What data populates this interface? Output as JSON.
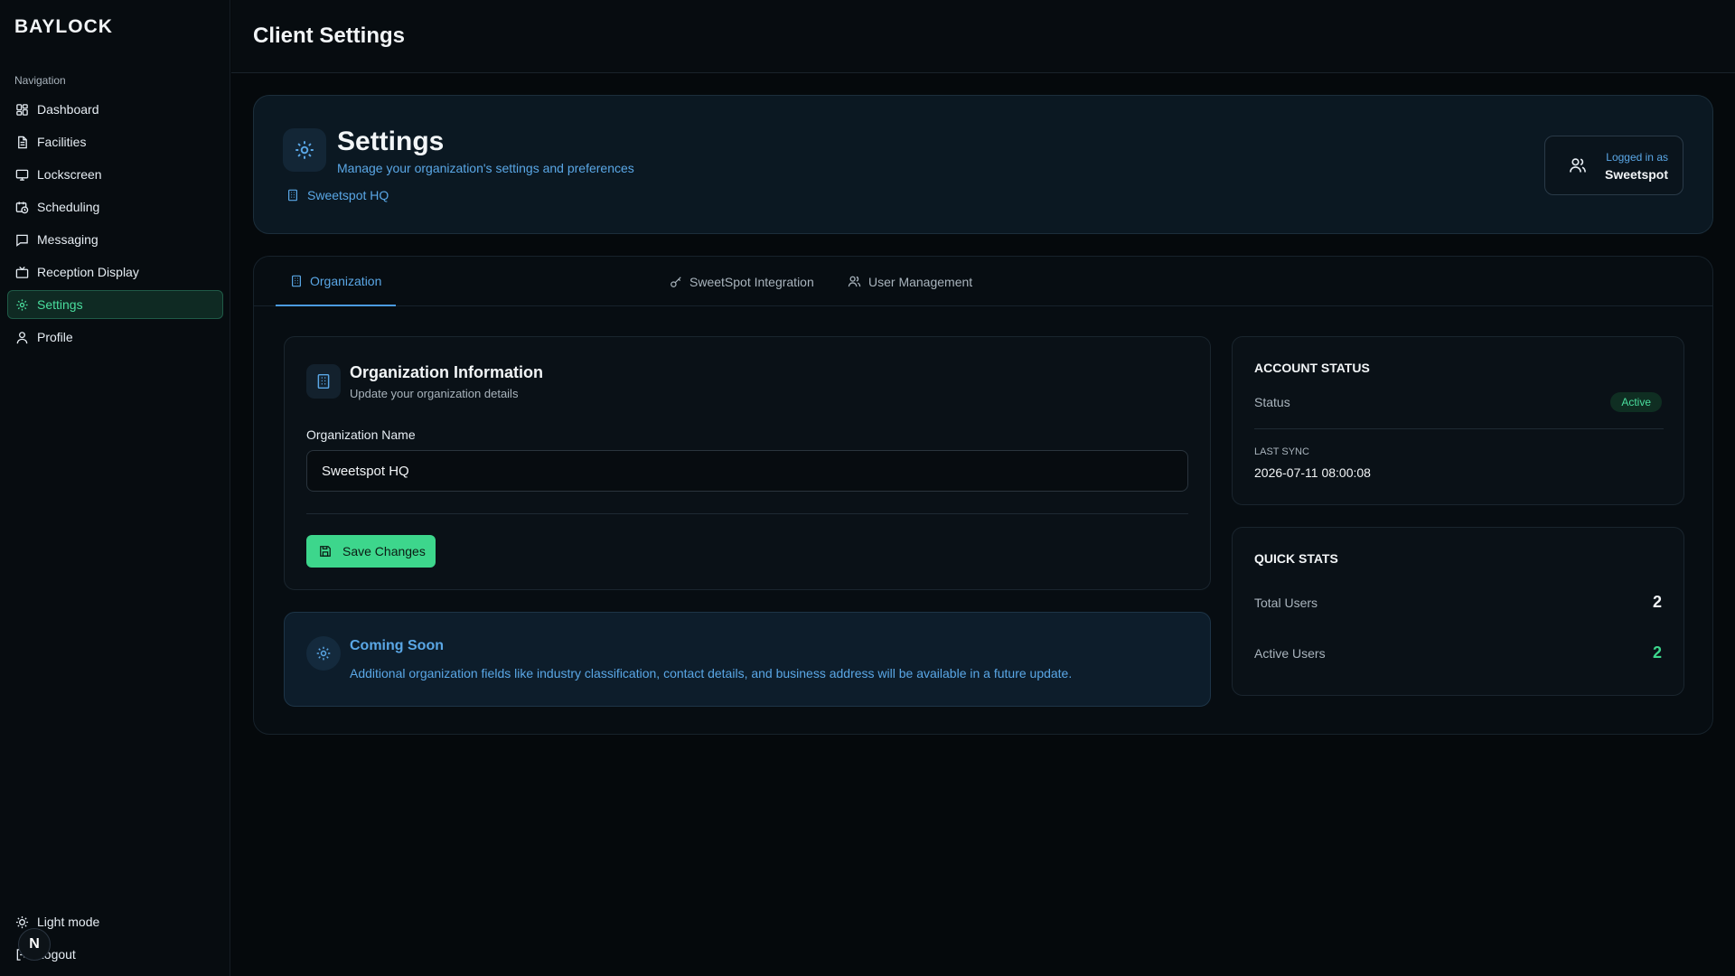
{
  "sidebar": {
    "brand": "BAYLOCK",
    "nav_heading": "Navigation",
    "items": [
      {
        "label": "Dashboard",
        "icon": "dashboard-icon"
      },
      {
        "label": "Facilities",
        "icon": "document-icon"
      },
      {
        "label": "Lockscreen",
        "icon": "monitor-icon"
      },
      {
        "label": "Scheduling",
        "icon": "calendar-clock-icon"
      },
      {
        "label": "Messaging",
        "icon": "message-icon"
      },
      {
        "label": "Reception Display",
        "icon": "tv-icon"
      },
      {
        "label": "Settings",
        "icon": "gear-icon",
        "active": true
      },
      {
        "label": "Profile",
        "icon": "user-icon"
      }
    ],
    "light_mode": "Light mode",
    "logout": "Logout",
    "avatar_initial": "N"
  },
  "header": {
    "title": "Client Settings"
  },
  "hero": {
    "title": "Settings",
    "subtitle": "Manage your organization's settings and preferences",
    "org_name": "Sweetspot HQ",
    "logged_in_label": "Logged in as",
    "logged_in_user": "Sweetspot"
  },
  "tabs": [
    {
      "label": "Organization",
      "icon": "building-icon",
      "active": true
    },
    {
      "label": "SweetSpot Integration",
      "icon": "key-icon"
    },
    {
      "label": "User Management",
      "icon": "users-icon"
    }
  ],
  "org_card": {
    "title": "Organization Information",
    "subtitle": "Update your organization details",
    "field_label": "Organization Name",
    "field_value": "Sweetspot HQ",
    "save_label": "Save Changes"
  },
  "coming_soon": {
    "title": "Coming Soon",
    "text": "Additional organization fields like industry classification, contact details, and business address will be available in a future update."
  },
  "account_status": {
    "title": "ACCOUNT STATUS",
    "status_label": "Status",
    "status_value": "Active",
    "last_sync_label": "LAST SYNC",
    "last_sync_value": "2026-07-11 08:00:08"
  },
  "quick_stats": {
    "title": "QUICK STATS",
    "total_users_label": "Total Users",
    "total_users_value": "2",
    "active_users_label": "Active Users",
    "active_users_value": "2"
  },
  "colors": {
    "accent_green": "#3dd68c",
    "accent_blue": "#5aa7e6",
    "background": "#05090c"
  }
}
